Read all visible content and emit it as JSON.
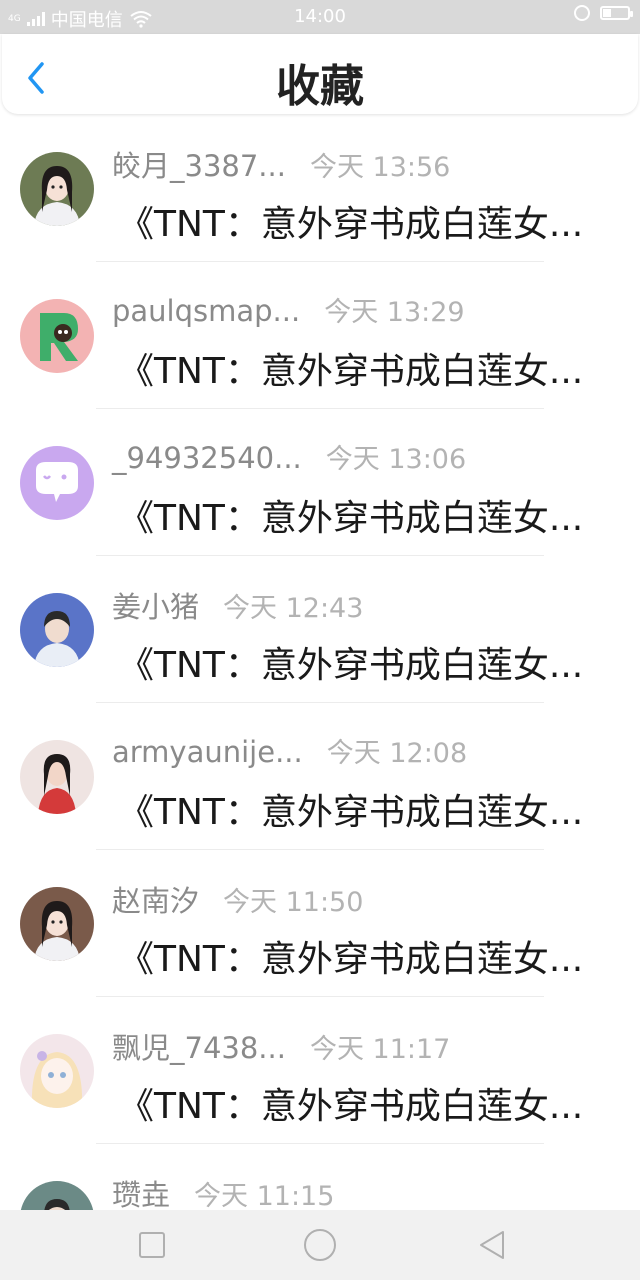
{
  "status_bar": {
    "carrier": "中国电信",
    "time": "14:00",
    "network_label": "4G",
    "battery_level": 0.35
  },
  "header": {
    "title": "收藏"
  },
  "items": [
    {
      "name": "皎月_3387...",
      "time": "今天 13:56",
      "title": "《TNT：意外穿书成白莲女...",
      "avatar": "portrait-girl-icon",
      "avatar_color": "#6d7b54"
    },
    {
      "name": "paulqsmap...",
      "time": "今天 13:29",
      "title": "《TNT：意外穿书成白莲女...",
      "avatar": "letter-r-icon",
      "avatar_color": "#f3b3b3"
    },
    {
      "name": "_94932540...",
      "time": "今天 13:06",
      "title": "《TNT：意外穿书成白莲女...",
      "avatar": "chat-bubble-icon",
      "avatar_color": "#c9a8ef"
    },
    {
      "name": "姜小猪",
      "time": "今天 12:43",
      "title": "《TNT：意外穿书成白莲女...",
      "avatar": "portrait-boy-icon",
      "avatar_color": "#5a74c8"
    },
    {
      "name": "armyaunije...",
      "time": "今天 12:08",
      "title": "《TNT：意外穿书成白莲女...",
      "avatar": "portrait-red-icon",
      "avatar_color": "#d43a3a"
    },
    {
      "name": "赵南汐",
      "time": "今天 11:50",
      "title": "《TNT：意外穿书成白莲女...",
      "avatar": "portrait-girl-icon",
      "avatar_color": "#7a5a4a"
    },
    {
      "name": "飘児_7438...",
      "time": "今天 11:17",
      "title": "《TNT：意外穿书成白莲女...",
      "avatar": "anime-girl-icon",
      "avatar_color": "#f3e6ea"
    },
    {
      "name": "瓒垚",
      "time": "今天 11:15",
      "title": "",
      "avatar": "portrait-boy-icon",
      "avatar_color": "#6b8a86"
    }
  ],
  "colors": {
    "accent": "#2196f3",
    "name_text": "#8a8a8a",
    "time_text": "#b3b3b3"
  }
}
